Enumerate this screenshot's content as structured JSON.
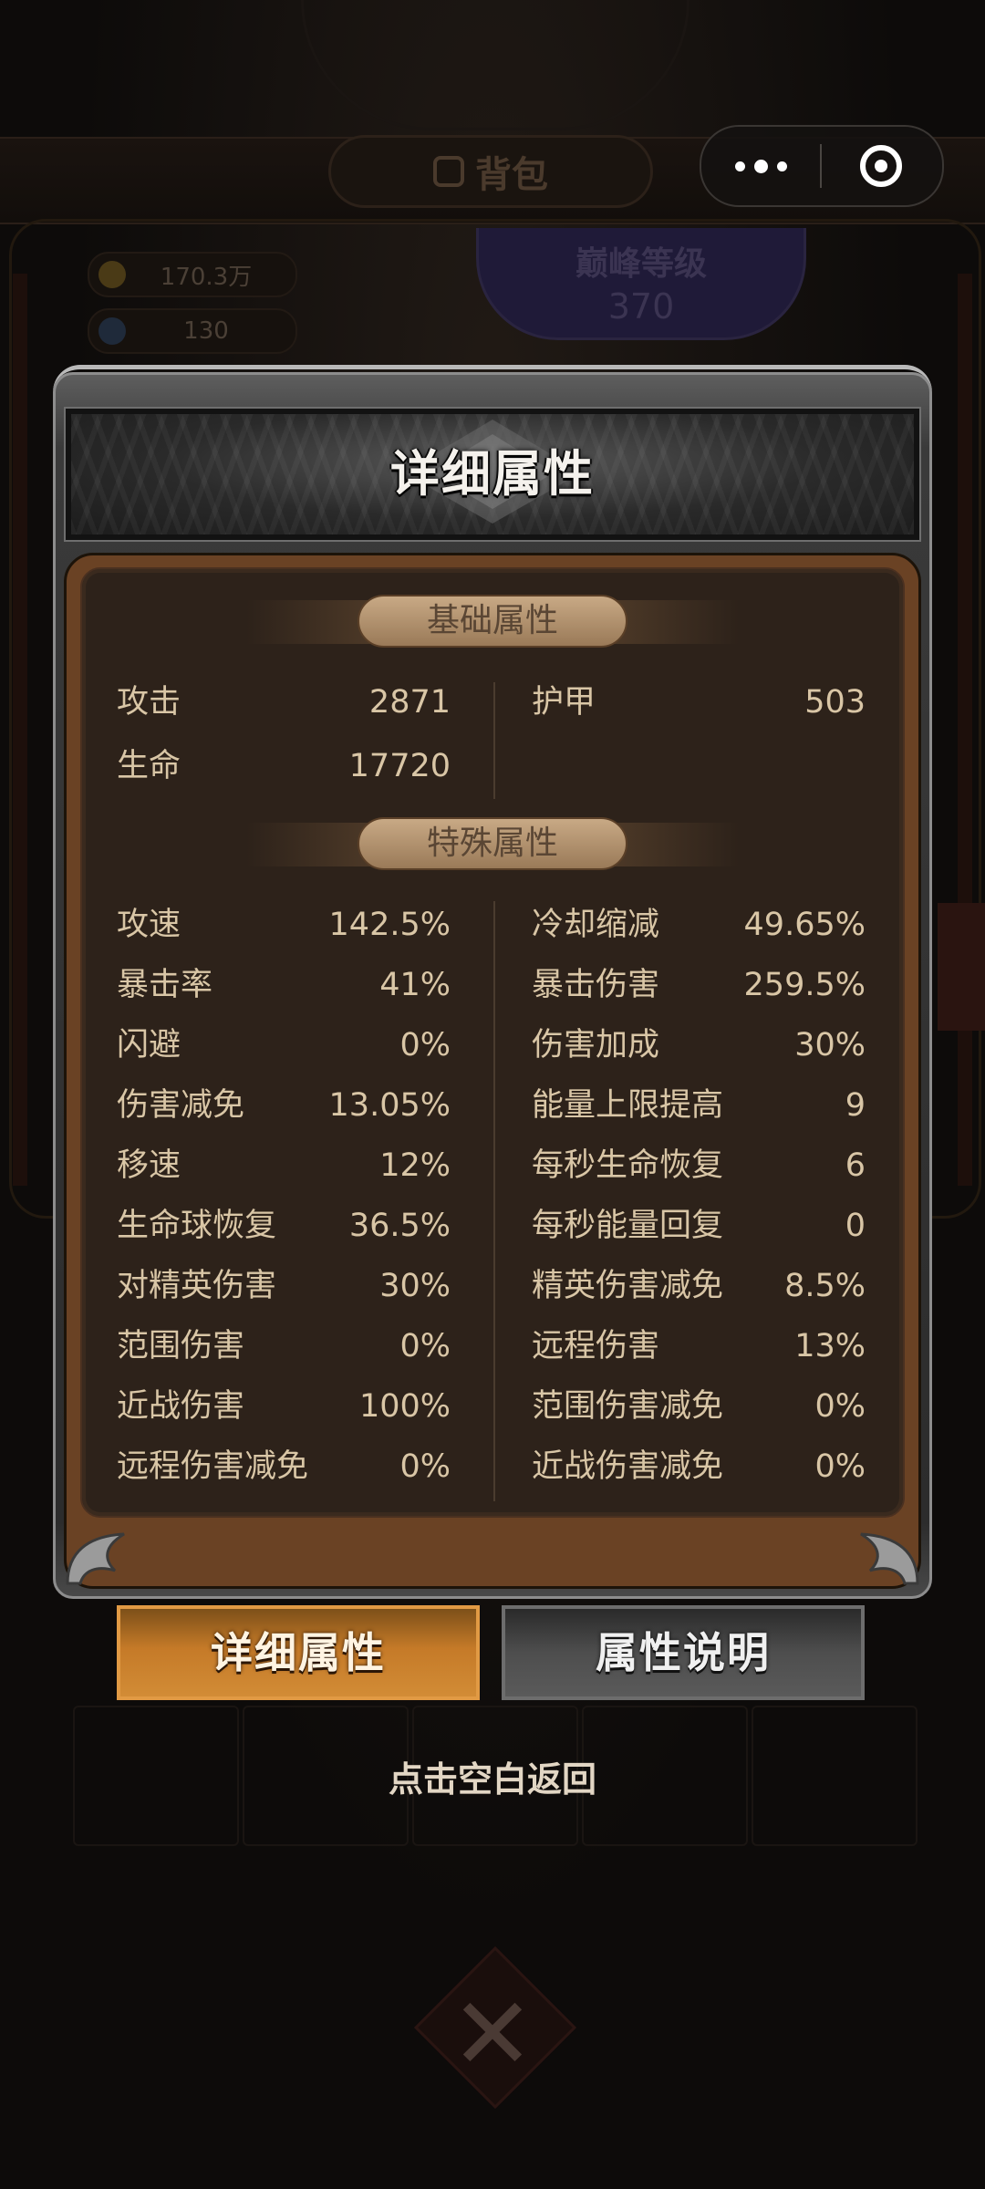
{
  "background": {
    "bag_tab_label": "背包",
    "gold_amount": "170.3万",
    "gem_amount": "130",
    "peak_level_label": "巅峰等级",
    "peak_level_value": "370"
  },
  "panel": {
    "title": "详细属性",
    "basic_section": "基础属性",
    "special_section": "特殊属性",
    "basic_left": [
      {
        "label": "攻击",
        "value": "2871"
      },
      {
        "label": "生命",
        "value": "17720"
      }
    ],
    "basic_right": [
      {
        "label": "护甲",
        "value": "503"
      }
    ],
    "special_left": [
      {
        "label": "攻速",
        "value": "142.5%"
      },
      {
        "label": "暴击率",
        "value": "41%"
      },
      {
        "label": "闪避",
        "value": "0%"
      },
      {
        "label": "伤害减免",
        "value": "13.05%"
      },
      {
        "label": "移速",
        "value": "12%"
      },
      {
        "label": "生命球恢复",
        "value": "36.5%"
      },
      {
        "label": "对精英伤害",
        "value": "30%"
      },
      {
        "label": "范围伤害",
        "value": "0%"
      },
      {
        "label": "近战伤害",
        "value": "100%"
      },
      {
        "label": "远程伤害减免",
        "value": "0%"
      }
    ],
    "special_right": [
      {
        "label": "冷却缩减",
        "value": "49.65%"
      },
      {
        "label": "暴击伤害",
        "value": "259.5%"
      },
      {
        "label": "伤害加成",
        "value": "30%"
      },
      {
        "label": "能量上限提高",
        "value": "9"
      },
      {
        "label": "每秒生命恢复",
        "value": "6"
      },
      {
        "label": "每秒能量回复",
        "value": "0"
      },
      {
        "label": "精英伤害减免",
        "value": "8.5%"
      },
      {
        "label": "远程伤害",
        "value": "13%"
      },
      {
        "label": "范围伤害减免",
        "value": "0%"
      },
      {
        "label": "近战伤害减免",
        "value": "0%"
      }
    ]
  },
  "tabs": {
    "detail_label": "详细属性",
    "explain_label": "属性说明"
  },
  "hint": "点击空白返回",
  "colors": {
    "accent_orange": "#c57a28",
    "panel_brown": "#6a4224",
    "text_beige": "#d9c6a6"
  }
}
